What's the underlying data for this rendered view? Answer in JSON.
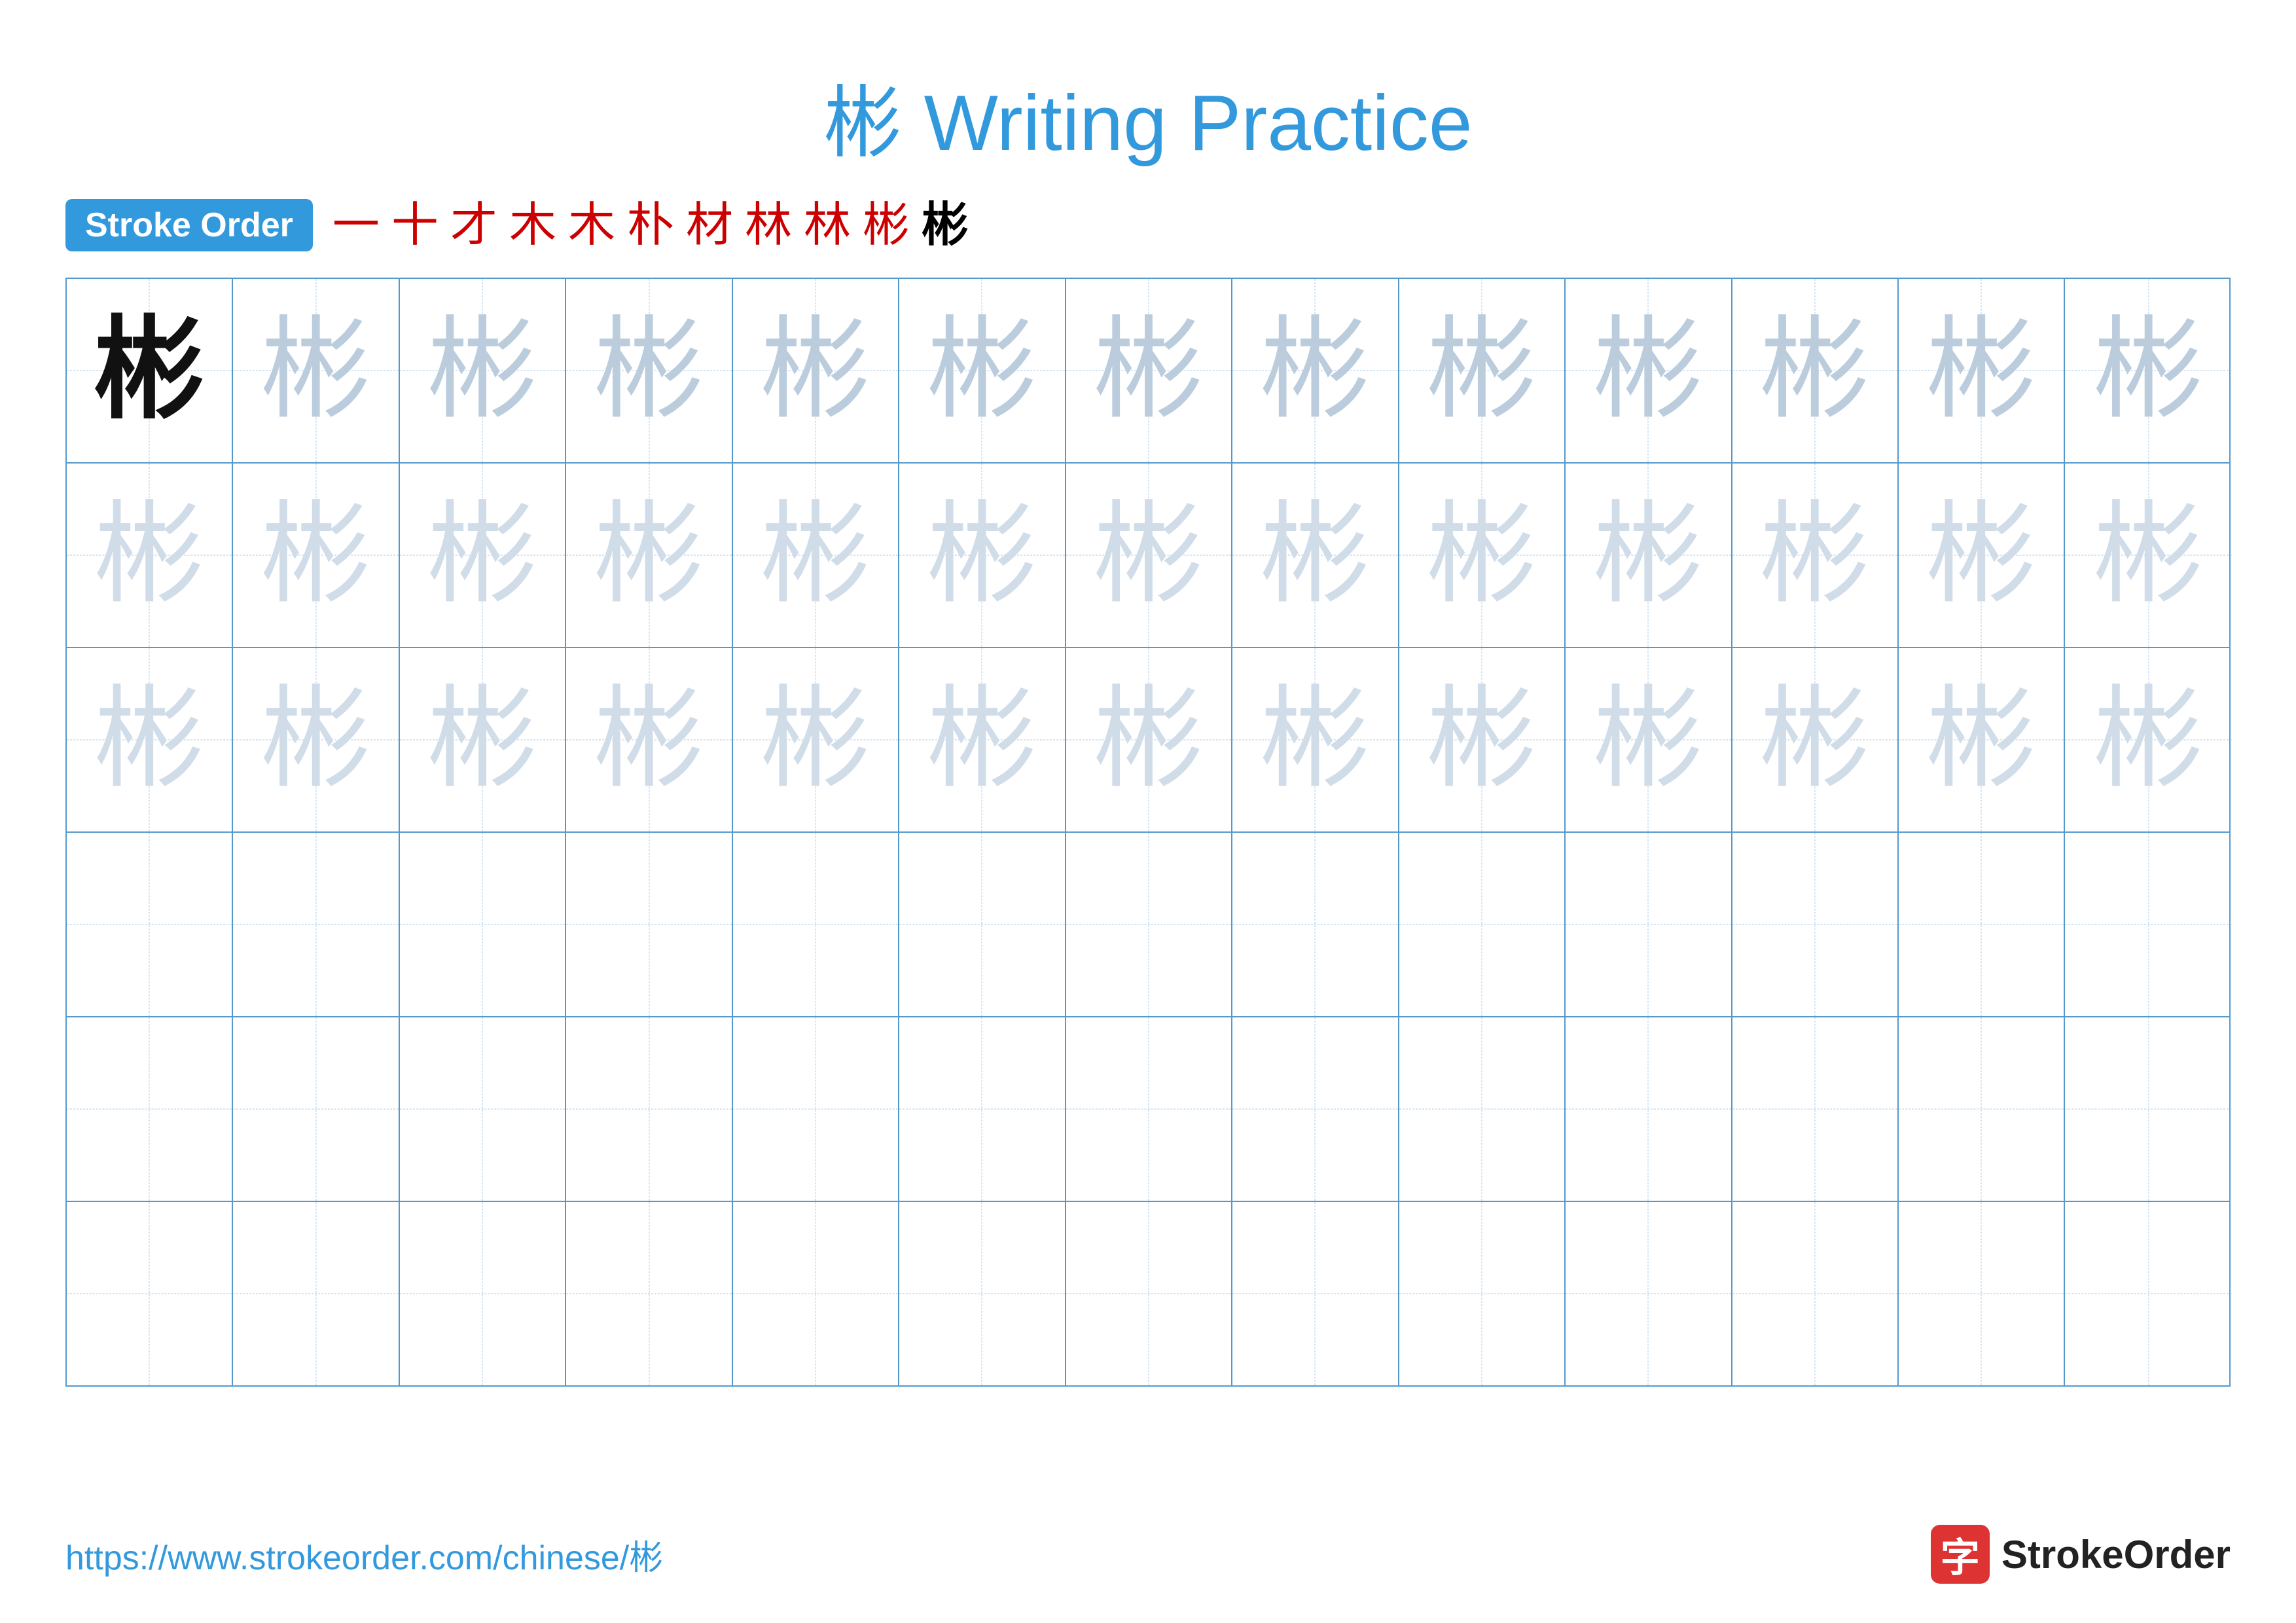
{
  "title": {
    "char": "彬",
    "text": "Writing Practice"
  },
  "stroke_order": {
    "badge_label": "Stroke Order",
    "steps": [
      "一",
      "十",
      "才",
      "木",
      "木",
      "朴",
      "材",
      "林",
      "林",
      "彬",
      "彬"
    ]
  },
  "grid": {
    "rows": 6,
    "cols": 13,
    "char": "彬",
    "row_types": [
      "dark_then_medium",
      "light",
      "light",
      "empty",
      "empty",
      "empty"
    ]
  },
  "footer": {
    "url": "https://www.strokeorder.com/chinese/彬",
    "brand_char": "字",
    "brand_name": "StrokeOrder"
  }
}
